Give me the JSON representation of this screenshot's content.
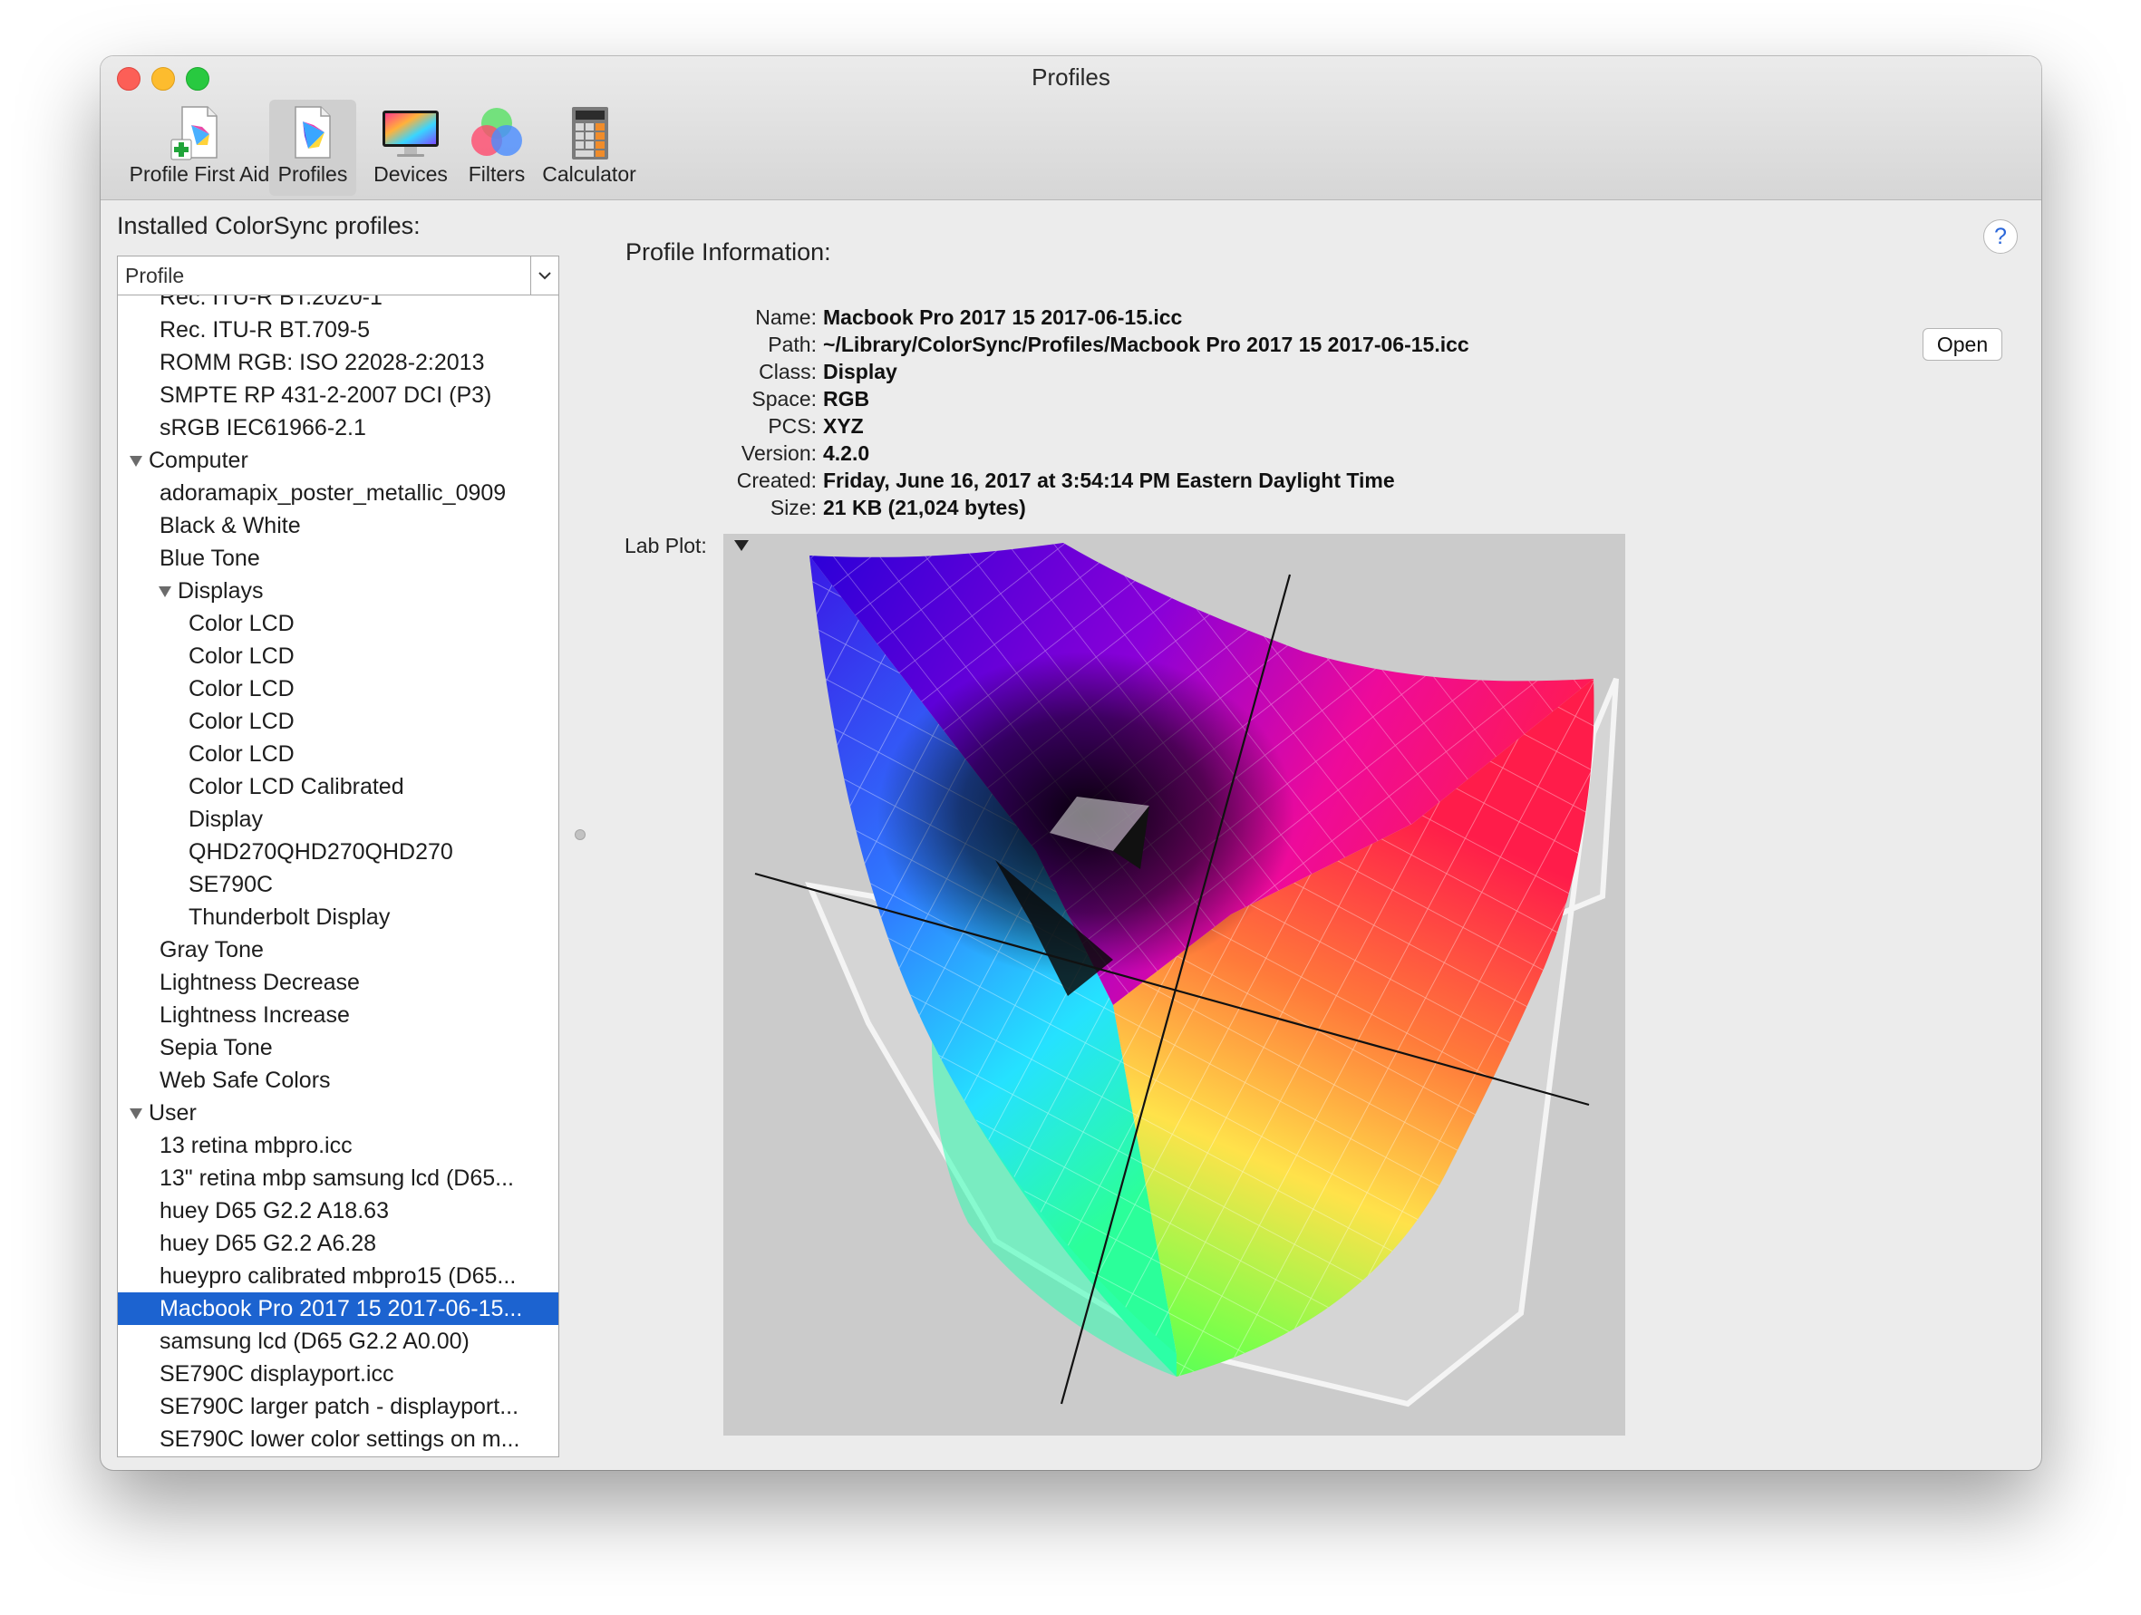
{
  "window": {
    "title": "Profiles"
  },
  "toolbar": {
    "items": [
      {
        "label": "Profile First Aid",
        "icon": "profile-first-aid-icon"
      },
      {
        "label": "Profiles",
        "icon": "profiles-icon",
        "selected": true
      },
      {
        "label": "Devices",
        "icon": "devices-icon"
      },
      {
        "label": "Filters",
        "icon": "filters-icon"
      },
      {
        "label": "Calculator",
        "icon": "calculator-icon"
      }
    ]
  },
  "sidebar": {
    "label": "Installed ColorSync profiles:",
    "column_header": "Profile",
    "rows": [
      {
        "label": "Rec. ITU-R BT.2020-1",
        "level": 2
      },
      {
        "label": "Rec. ITU-R BT.709-5",
        "level": 2
      },
      {
        "label": "ROMM RGB: ISO 22028-2:2013",
        "level": 2
      },
      {
        "label": "SMPTE RP 431-2-2007 DCI (P3)",
        "level": 2
      },
      {
        "label": "sRGB IEC61966-2.1",
        "level": 2
      },
      {
        "label": "Computer",
        "level": 1,
        "group": true
      },
      {
        "label": "adoramapix_poster_metallic_0909",
        "level": 2
      },
      {
        "label": "Black & White",
        "level": 2
      },
      {
        "label": "Blue Tone",
        "level": 2
      },
      {
        "label": "Displays",
        "level": 2,
        "group": true
      },
      {
        "label": "Color LCD",
        "level": 3
      },
      {
        "label": "Color LCD",
        "level": 3
      },
      {
        "label": "Color LCD",
        "level": 3
      },
      {
        "label": "Color LCD",
        "level": 3
      },
      {
        "label": "Color LCD",
        "level": 3
      },
      {
        "label": "Color LCD Calibrated",
        "level": 3
      },
      {
        "label": "Display",
        "level": 3
      },
      {
        "label": "QHD270QHD270QHD270",
        "level": 3
      },
      {
        "label": "SE790C",
        "level": 3
      },
      {
        "label": "Thunderbolt Display",
        "level": 3
      },
      {
        "label": "Gray Tone",
        "level": 2
      },
      {
        "label": "Lightness Decrease",
        "level": 2
      },
      {
        "label": "Lightness Increase",
        "level": 2
      },
      {
        "label": "Sepia Tone",
        "level": 2
      },
      {
        "label": "Web Safe Colors",
        "level": 2
      },
      {
        "label": "User",
        "level": 1,
        "group": true
      },
      {
        "label": "13 retina mbpro.icc",
        "level": 2
      },
      {
        "label": "13\" retina mbp samsung lcd (D65...",
        "level": 2
      },
      {
        "label": "huey D65 G2.2 A18.63",
        "level": 2
      },
      {
        "label": "huey D65 G2.2 A6.28",
        "level": 2
      },
      {
        "label": "hueypro calibrated mbpro15 (D65...",
        "level": 2
      },
      {
        "label": "Macbook Pro 2017 15 2017-06-15...",
        "level": 2,
        "selected": true
      },
      {
        "label": "samsung lcd (D65 G2.2 A0.00)",
        "level": 2
      },
      {
        "label": "SE790C displayport.icc",
        "level": 2
      },
      {
        "label": "SE790C larger patch - displayport...",
        "level": 2
      },
      {
        "label": "SE790C lower color settings on m...",
        "level": 2
      }
    ]
  },
  "info": {
    "title": "Profile Information:",
    "help": "?",
    "open_label": "Open",
    "fields": [
      {
        "key": "Name:",
        "value": "Macbook Pro 2017 15 2017-06-15.icc"
      },
      {
        "key": "Path:",
        "value": "~/Library/ColorSync/Profiles/Macbook Pro 2017 15 2017-06-15.icc"
      },
      {
        "key": "Class:",
        "value": "Display"
      },
      {
        "key": "Space:",
        "value": "RGB"
      },
      {
        "key": "PCS:",
        "value": "XYZ"
      },
      {
        "key": "Version:",
        "value": "4.2.0"
      },
      {
        "key": "Created:",
        "value": "Friday, June 16, 2017 at 3:54:14 PM Eastern Daylight Time"
      },
      {
        "key": "Size:",
        "value": "21 KB (21,024 bytes)"
      }
    ],
    "lab_plot_label": "Lab Plot:"
  },
  "colors": {
    "selection": "#1c63d0",
    "plot_background": "#cbcbcb",
    "gamut_top_left": "#2a00d8",
    "gamut_top_right": "#ee0a9a",
    "gamut_right": "#ffe24a",
    "gamut_bottom": "#26ff6c",
    "gamut_left": "#30e8ff"
  }
}
